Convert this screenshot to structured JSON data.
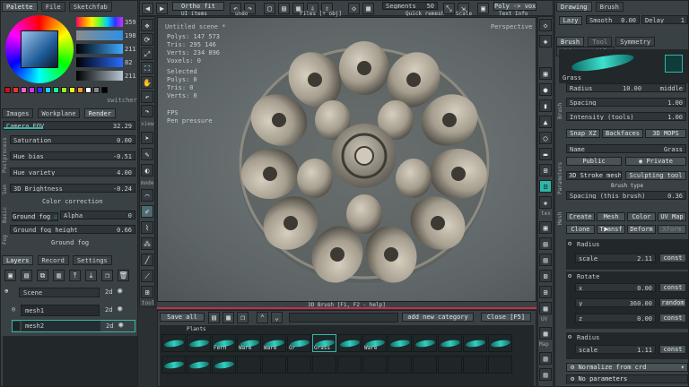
{
  "left_panel": {
    "tabs": [
      "Palette",
      "File",
      "Sketchfab"
    ],
    "color_values": [
      "359",
      "198",
      "211",
      "82",
      "211"
    ],
    "switcher_label": "switcher",
    "render_tabs": [
      "Images",
      "Workplane",
      "Render"
    ],
    "camera_fov": {
      "label": "Camera FOV",
      "value": "32.29"
    },
    "adjust": [
      {
        "label": "Saturation",
        "value": "0.00"
      },
      {
        "label": "Hue bias",
        "value": "-0.51"
      },
      {
        "label": "Hue variety",
        "value": "4.00"
      },
      {
        "label": "3D Brightness",
        "value": "-0.24"
      }
    ],
    "color_correction": "Color correction",
    "ground_fog_button": "Ground fog",
    "alpha": {
      "label": "Alpha",
      "value": "0"
    },
    "ground_fog_height": {
      "label": "Ground fog height",
      "value": "0.66"
    },
    "ground_fog_footer": "Ground fog",
    "section_labels": [
      "Postprocess",
      "Sun",
      "Basic",
      "Fog"
    ]
  },
  "layers": {
    "tabs": [
      "Layers",
      "Record",
      "Settings"
    ],
    "items": [
      {
        "name": "Scene",
        "mode": "2d"
      },
      {
        "name": "mesh1",
        "mode": "2d"
      },
      {
        "name": "mesh2",
        "mode": "2d"
      }
    ]
  },
  "top_toolbar": {
    "ortho_button": "Ortho fit",
    "ui_items_label": "UI items",
    "undo_label": "undo",
    "files_label": "Files [+ obj]",
    "segments": {
      "label": "Segments",
      "value": "50"
    },
    "quick_remesh": "Quick remesh",
    "scale_label": "Scale",
    "poly_to_vox": "Poly -> vox",
    "texture_label": "Text Info"
  },
  "viewport": {
    "title": "Untitled scene *",
    "perspective": "Perspective",
    "stats": [
      {
        "label": "Polys",
        "value": "147 573"
      },
      {
        "label": "Tris",
        "value": "295 146"
      },
      {
        "label": "Verts",
        "value": "234 896"
      },
      {
        "label": "Voxels",
        "value": "0"
      }
    ],
    "selected_label": "Selected",
    "selected_stats": [
      {
        "label": "Polys",
        "value": "0"
      },
      {
        "label": "Tris",
        "value": "0"
      },
      {
        "label": "Verts",
        "value": "0"
      }
    ],
    "fps": "FPS",
    "pen_pressure": "Pen pressure",
    "status": "3D Brush  [F1, F2 - help]"
  },
  "left_tools": [
    "move",
    "rotate",
    "scale",
    "fit",
    "pan",
    "undo",
    "redo",
    "grid"
  ],
  "left_tools_labels": [
    "view",
    "mode",
    "tool"
  ],
  "bottom_toolbar": {
    "save_all": "Save all",
    "add_category": "add new category",
    "close": "Close [F5]",
    "category": "Plants",
    "items": [
      "",
      "",
      "Fern",
      "Ware",
      "Ware",
      "Gr",
      "Grass",
      "",
      "Ware",
      "",
      "",
      "",
      "",
      "",
      ""
    ]
  },
  "right_tools_labels": [
    "tex",
    "UV",
    "Map"
  ],
  "drawing_panel": {
    "tabs": [
      "Drawing",
      "Brush"
    ],
    "lazy_label": "Lazy",
    "smooth": {
      "label": "Smooth",
      "value": "0.00"
    },
    "delay": {
      "label": "Delay",
      "value": "1"
    },
    "brush_tabs": [
      "Brush",
      "Tool",
      "Symmetry",
      "Object modify"
    ],
    "brush_name": "Grass",
    "radius": {
      "label": "Radius",
      "value": "10.00",
      "mode": "middle"
    },
    "spacing": {
      "label": "Spacing",
      "value": "1.00"
    },
    "intensity": {
      "label": "Intensity (tools)",
      "value": "1.00"
    },
    "toggles": [
      "Snap XZ",
      "Backfaces",
      "3D MOPS"
    ],
    "section_labels": [
      "Brush",
      "Parameters",
      "Mesh"
    ]
  },
  "params_panel": {
    "name": {
      "label": "Name",
      "value": "Grass"
    },
    "public_label": "Public",
    "private_label": "Private",
    "stroke_mesh": "3D Stroke mesh",
    "sculpting_tool": "Sculpting tool",
    "brush_type_label": "Brush type",
    "spacing_this": {
      "label": "Spacing (this brush)",
      "value": "0.36"
    },
    "actions": [
      "Create",
      "Mesh",
      "Color",
      "UV Map"
    ],
    "actions2": [
      "Clone",
      "Transf",
      "Deform",
      "Xform"
    ],
    "radius_group": {
      "title": "Radius",
      "scale_label": "scale",
      "scale_value": "2.11",
      "const_label": "const"
    },
    "rotate_group": {
      "title": "Rotate",
      "rows": [
        {
          "label": "x",
          "value": "0.00",
          "tag": "const"
        },
        {
          "label": "y",
          "value": "360.00",
          "tag": "random"
        },
        {
          "label": "z",
          "value": "0.00",
          "tag": "const"
        }
      ]
    },
    "radius2_group": {
      "title": "Radius",
      "scale_label": "scale",
      "scale_value": "1.11",
      "const_label": "const"
    },
    "normalize": "Normalize from crd",
    "no_parameters": "No parameters"
  },
  "colors": {
    "accent": "#2fb7a8",
    "panel": "#3a4145",
    "dark": "#22272a",
    "status_line": "#c2304a"
  }
}
